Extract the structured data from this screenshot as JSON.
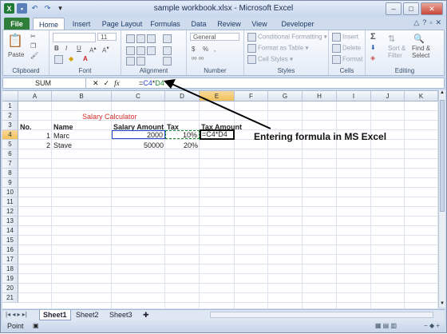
{
  "window": {
    "title": "sample workbook.xlsx - Microsoft Excel",
    "controls": [
      "–",
      "□",
      "✕"
    ]
  },
  "tabs": [
    "File",
    "Home",
    "Insert",
    "Page Layout",
    "Formulas",
    "Data",
    "Review",
    "View",
    "Developer"
  ],
  "ribbon": {
    "clipboard": {
      "label": "Clipboard",
      "paste": "Paste"
    },
    "font": {
      "label": "Font",
      "size": "11",
      "bold": "B",
      "italic": "I",
      "underline": "U"
    },
    "alignment": {
      "label": "Alignment"
    },
    "number": {
      "label": "Number",
      "format": "General",
      "currency": "$",
      "percent": "%"
    },
    "styles": {
      "label": "Styles",
      "cond": "Conditional Formatting",
      "table": "Format as Table",
      "cell": "Cell Styles"
    },
    "cells": {
      "label": "Cells",
      "insert": "Insert",
      "delete": "Delete",
      "format": "Format"
    },
    "editing": {
      "label": "Editing",
      "sigma": "Σ",
      "sort": "Sort &",
      "filter": "Filter",
      "find": "Find &",
      "select": "Select"
    }
  },
  "formula_bar": {
    "name_box": "SUM",
    "cancel": "✕",
    "enter": "✓",
    "fx": "fx",
    "formula_prefix": "=",
    "formula_ref1": "C4",
    "formula_op": "*",
    "formula_ref2": "D4"
  },
  "columns": [
    "A",
    "B",
    "C",
    "D",
    "E",
    "F",
    "G",
    "H",
    "I",
    "J",
    "K"
  ],
  "rows": [
    "1",
    "2",
    "3",
    "4",
    "5",
    "6",
    "7",
    "8",
    "9",
    "10",
    "11",
    "12",
    "13",
    "14",
    "15",
    "16",
    "17",
    "18",
    "19",
    "20",
    "21"
  ],
  "cells": {
    "title": "Salary Calculator",
    "hdr_no": "No.",
    "hdr_name": "Name",
    "hdr_salary": "Salary Amount",
    "hdr_tax": "Tax",
    "hdr_taxamt": "Tax Amount",
    "r4_no": "1",
    "r4_name": "Marc",
    "r4_salary": "2000",
    "r4_tax": "10%",
    "r4_formula": "=C4*D4",
    "r5_no": "2",
    "r5_name": "Stave",
    "r5_salary": "50000",
    "r5_tax": "20%"
  },
  "sheets": [
    "Sheet1",
    "Sheet2",
    "Sheet3"
  ],
  "status": {
    "mode": "Point"
  },
  "annotation": "Entering formula in MS Excel",
  "colors": {
    "ref_c4": "#2244cc",
    "ref_d4": "#1a8a2a",
    "title_red": "#d22b2b",
    "file_tab": "#2f7e3a"
  }
}
